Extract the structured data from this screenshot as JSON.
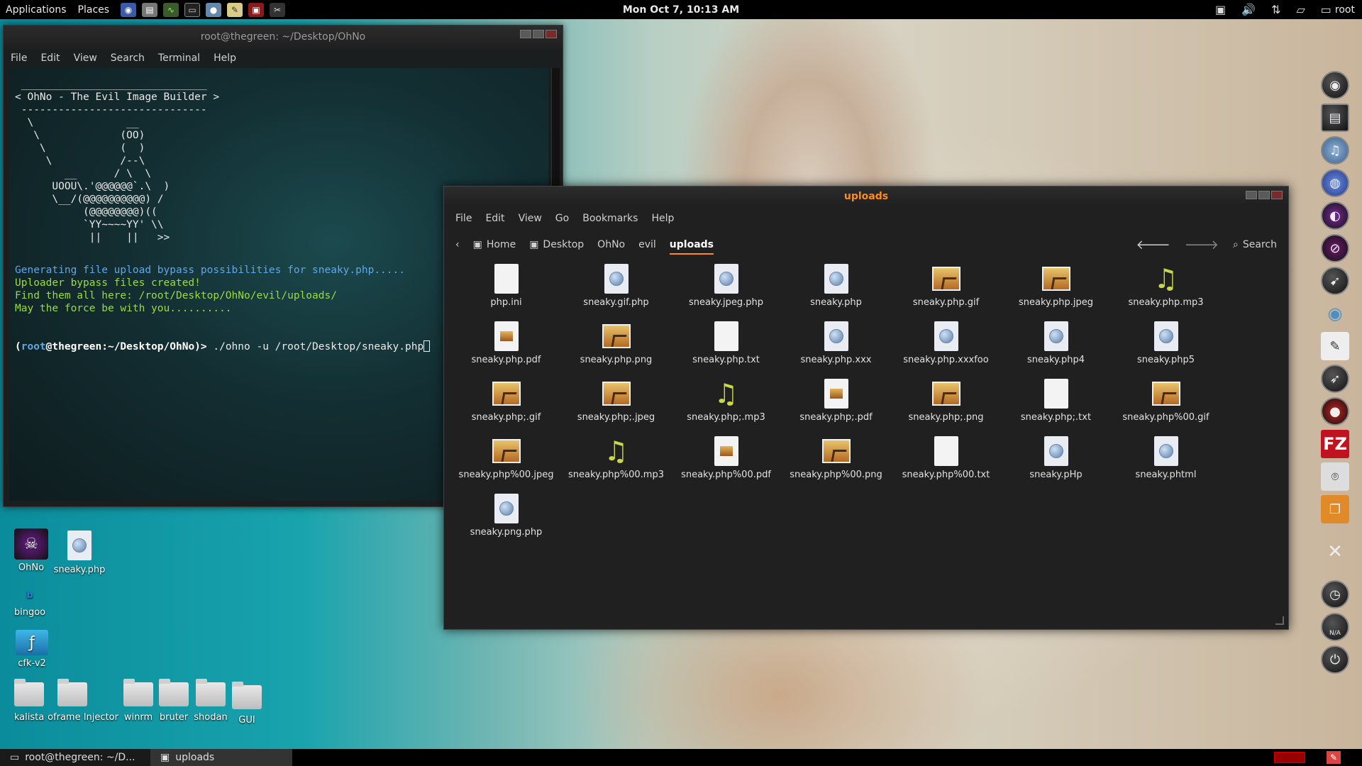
{
  "top_panel": {
    "applications": "Applications",
    "places": "Places",
    "launchers": [
      "browser-icon",
      "save-icon",
      "monitor-icon",
      "terminal-icon",
      "iceweasel-icon",
      "notes-icon",
      "display-icon",
      "tools-icon"
    ],
    "clock": "Mon Oct  7, 10:13 AM",
    "user": "root"
  },
  "terminal": {
    "title": "root@thegreen: ~/Desktop/OhNo",
    "menu": [
      "File",
      "Edit",
      "View",
      "Search",
      "Terminal",
      "Help"
    ],
    "banner": " ______________________________\n< OhNo - The Evil Image Builder >\n ------------------------------\n  \\               __\n   \\             (OO)\n    \\            (  )\n     \\           /--\\\n        __      / \\  \\\n      UOOU\\.'@@@@@@`.\\  )\n      \\__/(@@@@@@@@@@) /\n           (@@@@@@@@)((\n           `YY~~~~YY' \\\\\n            ||    ||   >>",
    "lines": [
      "Generating file upload bypass possibilities for sneaky.php.....",
      "Uploader bypass files created!",
      "Find them all here: /root/Desktop/OhNo/evil/uploads/",
      "May the force be with you.........."
    ],
    "prompt": {
      "open": "(",
      "user": "root",
      "at": "@",
      "host": "thegreen",
      "path": ":~/Desktop/OhNo)>",
      "command": " ./ohno -u /root/Desktop/sneaky.php"
    }
  },
  "file_manager": {
    "title": "uploads",
    "menu": [
      "File",
      "Edit",
      "View",
      "Go",
      "Bookmarks",
      "Help"
    ],
    "breadcrumbs": [
      "Home",
      "Desktop",
      "OhNo",
      "evil",
      "uploads"
    ],
    "search_label": "Search",
    "files": [
      {
        "name": "php.ini",
        "type": "doc"
      },
      {
        "name": "sneaky.gif.php",
        "type": "php"
      },
      {
        "name": "sneaky.jpeg.php",
        "type": "php"
      },
      {
        "name": "sneaky.php",
        "type": "php"
      },
      {
        "name": "sneaky.php.gif",
        "type": "img"
      },
      {
        "name": "sneaky.php.jpeg",
        "type": "img"
      },
      {
        "name": "sneaky.php.mp3",
        "type": "music"
      },
      {
        "name": "sneaky.php.pdf",
        "type": "pdf"
      },
      {
        "name": "sneaky.php.png",
        "type": "img"
      },
      {
        "name": "sneaky.php.txt",
        "type": "doc"
      },
      {
        "name": "sneaky.php.xxx",
        "type": "php"
      },
      {
        "name": "sneaky.php.xxxfoo",
        "type": "php"
      },
      {
        "name": "sneaky.php4",
        "type": "php"
      },
      {
        "name": "sneaky.php5",
        "type": "php"
      },
      {
        "name": "sneaky.php;.gif",
        "type": "img"
      },
      {
        "name": "sneaky.php;.jpeg",
        "type": "img"
      },
      {
        "name": "sneaky.php;.mp3",
        "type": "music"
      },
      {
        "name": "sneaky.php;.pdf",
        "type": "pdf"
      },
      {
        "name": "sneaky.php;.png",
        "type": "img"
      },
      {
        "name": "sneaky.php;.txt",
        "type": "doc"
      },
      {
        "name": "sneaky.php%00.gif",
        "type": "img"
      },
      {
        "name": "sneaky.php%00.jpeg",
        "type": "img"
      },
      {
        "name": "sneaky.php%00.mp3",
        "type": "music"
      },
      {
        "name": "sneaky.php%00.pdf",
        "type": "pdf"
      },
      {
        "name": "sneaky.php%00.png",
        "type": "img"
      },
      {
        "name": "sneaky.php%00.txt",
        "type": "doc"
      },
      {
        "name": "sneaky.pHp",
        "type": "php"
      },
      {
        "name": "sneaky.phtml",
        "type": "php"
      },
      {
        "name": "sneaky.png.php",
        "type": "php"
      }
    ]
  },
  "desktop": {
    "ohno": "OhNo",
    "sneaky": "sneaky.php",
    "bingoo": "bingoo",
    "cfk": "cfk-v2",
    "folders": [
      "kalista",
      "oframe Injector",
      "winrm",
      "bruter",
      "shodan",
      "GUI"
    ]
  },
  "dock": {
    "icons": [
      "music-app-icon",
      "window-icon",
      "itunes-icon",
      "globe-icon",
      "dark-app-icon",
      "stop-icon",
      "rocket-icon",
      "eye-icon",
      "notepad-icon",
      "bird-icon",
      "redeye-icon",
      "filezilla-icon",
      "camera-icon",
      "window-stack-icon",
      "tools-icon",
      "clock-icon",
      "battery-icon",
      "power-icon"
    ],
    "fz": "FZ",
    "na": "N/A"
  },
  "bottom_panel": {
    "task1": "root@thegreen: ~/D...",
    "task2": "uploads"
  }
}
